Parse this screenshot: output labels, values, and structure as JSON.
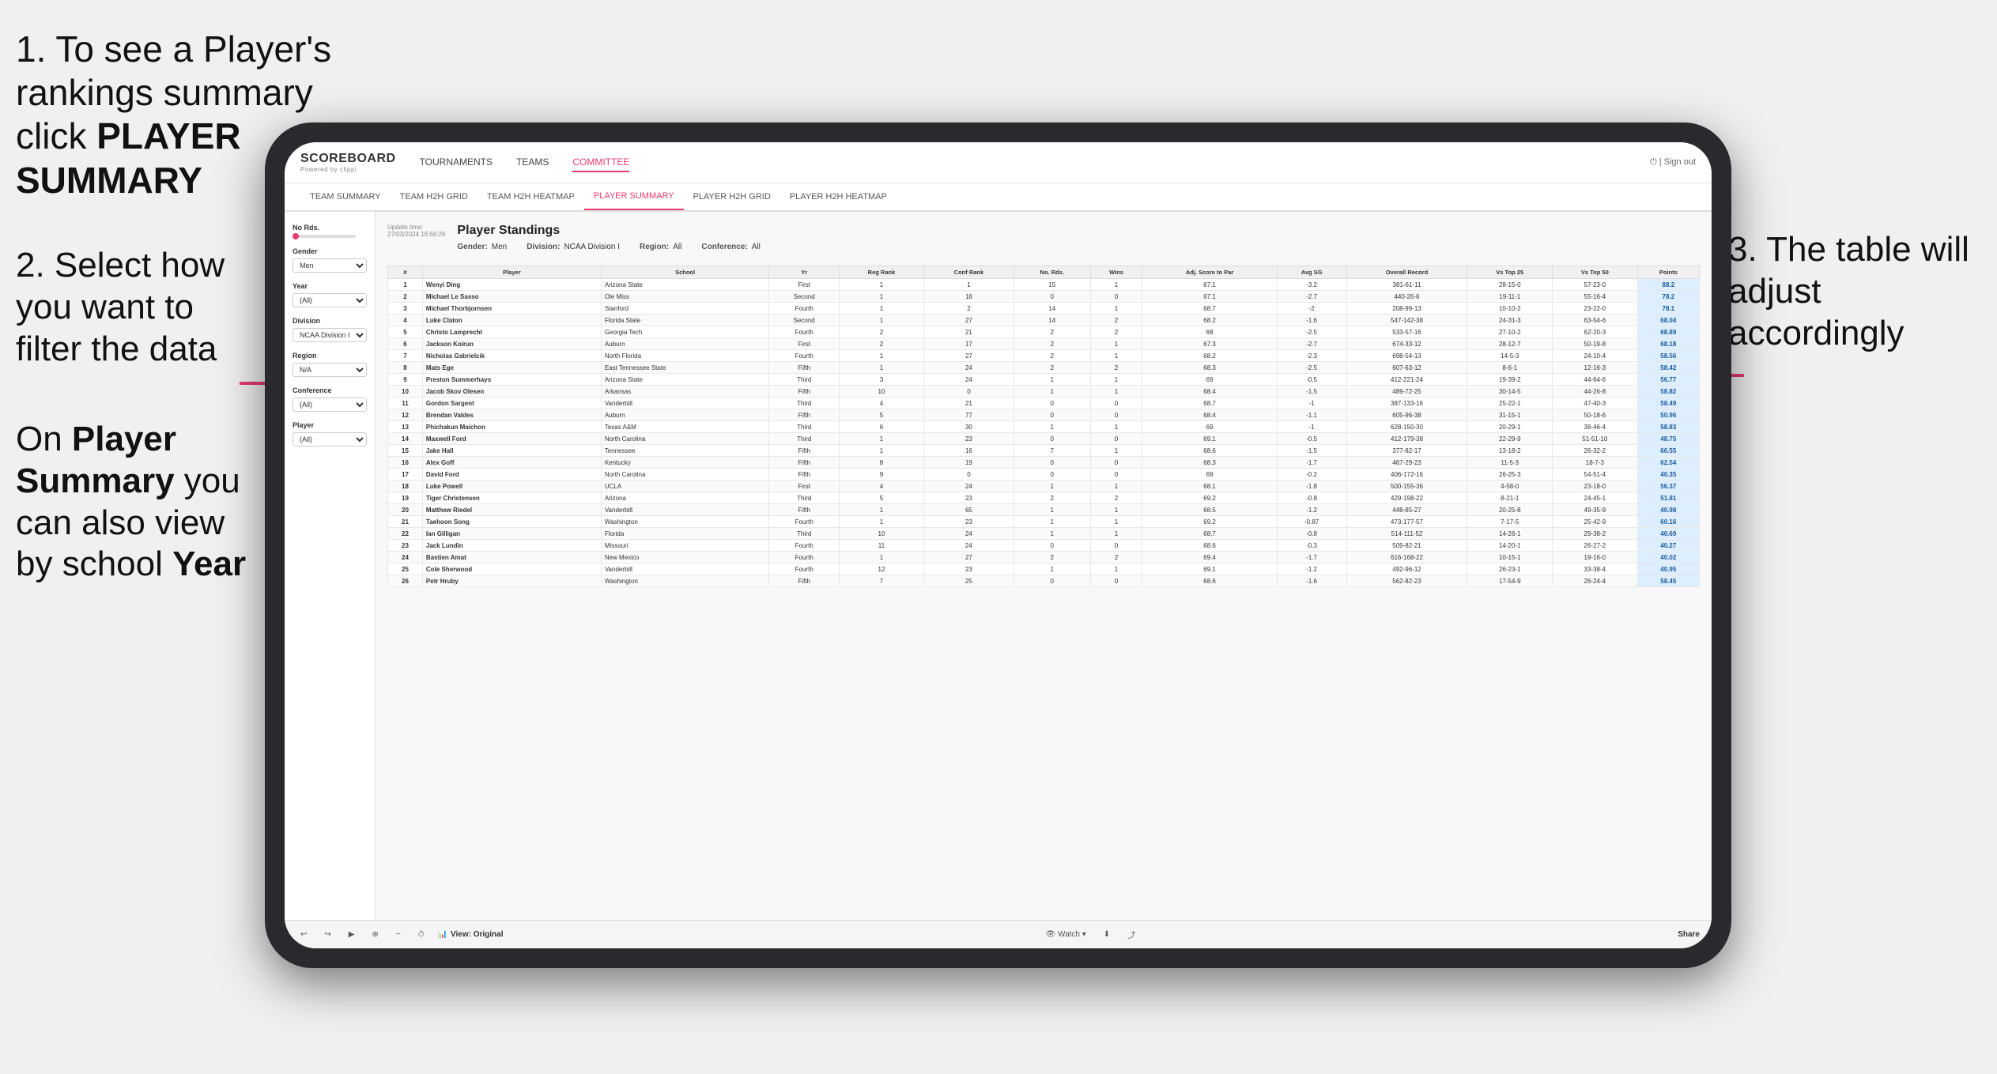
{
  "instructions": {
    "step1": "1. To see a Player's rankings summary click ",
    "step1_bold": "PLAYER SUMMARY",
    "step2_line1": "2. Select how",
    "step2_line2": "you want to",
    "step2_line3": "filter the data",
    "step3": "3. The table will adjust accordingly",
    "bottom_note_pre": "On ",
    "bottom_note_bold1": "Player Summary",
    "bottom_note_mid": " you can also view by school ",
    "bottom_note_bold2": "Year"
  },
  "header": {
    "logo": "SCOREBOARD",
    "logo_sub": "Powered by clippi",
    "sign_out": "Sign out",
    "nav": [
      {
        "label": "TOURNAMENTS",
        "active": false
      },
      {
        "label": "TEAMS",
        "active": false
      },
      {
        "label": "COMMITTEE",
        "active": false
      }
    ],
    "subnav": [
      {
        "label": "TEAM SUMMARY",
        "active": false
      },
      {
        "label": "TEAM H2H GRID",
        "active": false
      },
      {
        "label": "TEAM H2H HEATMAP",
        "active": false
      },
      {
        "label": "PLAYER SUMMARY",
        "active": true
      },
      {
        "label": "PLAYER H2H GRID",
        "active": false
      },
      {
        "label": "PLAYER H2H HEATMAP",
        "active": false
      }
    ]
  },
  "filters": {
    "update_time_label": "Update time:",
    "update_time": "27/03/2024 16:56:26",
    "gender_label": "Gender:",
    "gender_value": "Men",
    "division_label": "Division:",
    "division_value": "NCAA Division I",
    "region_label": "Region:",
    "region_value": "All",
    "conference_label": "Conference:",
    "conference_value": "All"
  },
  "sidebar": {
    "no_rds_label": "No Rds.",
    "gender_label": "Gender",
    "gender_value": "Men",
    "year_label": "Year",
    "year_value": "(All)",
    "division_label": "Division",
    "division_value": "NCAA Division I",
    "region_label": "Region",
    "region_value": "N/A",
    "conference_label": "Conference",
    "conference_value": "(All)",
    "player_label": "Player",
    "player_value": "(All)"
  },
  "table": {
    "title": "Player Standings",
    "columns": [
      "#",
      "Player",
      "School",
      "Yr",
      "Reg Rank",
      "Conf Rank",
      "No. Rds.",
      "Wins",
      "Adj. Score to Par",
      "Avg SG",
      "Overall Record",
      "Vs Top 25",
      "Vs Top 50",
      "Points"
    ],
    "rows": [
      {
        "num": 1,
        "player": "Wenyi Ding",
        "school": "Arizona State",
        "yr": "First",
        "reg_rank": 1,
        "conf_rank": 1,
        "no_rds": 15,
        "wins": 1,
        "adj_score": 67.1,
        "avg_sg": -3.2,
        "overall": "381-61-11",
        "vt25": "28-15-0",
        "vt50": "57-23-0",
        "points": "88.2"
      },
      {
        "num": 2,
        "player": "Michael Le Sasso",
        "school": "Ole Miss",
        "yr": "Second",
        "reg_rank": 1,
        "conf_rank": 18,
        "no_rds": 0,
        "wins": 0,
        "adj_score": 67.1,
        "avg_sg": -2.7,
        "overall": "440-26-6",
        "vt25": "19-11-1",
        "vt50": "55-16-4",
        "points": "78.2"
      },
      {
        "num": 3,
        "player": "Michael Thorbjornsen",
        "school": "Stanford",
        "yr": "Fourth",
        "reg_rank": 1,
        "conf_rank": 2,
        "no_rds": 14,
        "wins": 1,
        "adj_score": 68.7,
        "avg_sg": -2.0,
        "overall": "208-99-13",
        "vt25": "10-10-2",
        "vt50": "23-22-0",
        "points": "78.1"
      },
      {
        "num": 4,
        "player": "Luke Claton",
        "school": "Florida State",
        "yr": "Second",
        "reg_rank": 1,
        "conf_rank": 27,
        "no_rds": 14,
        "wins": 2,
        "adj_score": 68.2,
        "avg_sg": -1.6,
        "overall": "547-142-38",
        "vt25": "24-31-3",
        "vt50": "63-54-6",
        "points": "68.04"
      },
      {
        "num": 5,
        "player": "Christo Lamprecht",
        "school": "Georgia Tech",
        "yr": "Fourth",
        "reg_rank": 2,
        "conf_rank": 21,
        "no_rds": 2,
        "wins": 2,
        "adj_score": 68.0,
        "avg_sg": -2.5,
        "overall": "533-57-16",
        "vt25": "27-10-2",
        "vt50": "62-20-3",
        "points": "68.89"
      },
      {
        "num": 6,
        "player": "Jackson Koirun",
        "school": "Auburn",
        "yr": "First",
        "reg_rank": 2,
        "conf_rank": 17,
        "no_rds": 2,
        "wins": 1,
        "adj_score": 67.3,
        "avg_sg": -2.7,
        "overall": "674-33-12",
        "vt25": "28-12-7",
        "vt50": "50-19-8",
        "points": "68.18"
      },
      {
        "num": 7,
        "player": "Nicholas Gabrielcik",
        "school": "North Florida",
        "yr": "Fourth",
        "reg_rank": 1,
        "conf_rank": 27,
        "no_rds": 2,
        "wins": 1,
        "adj_score": 68.2,
        "avg_sg": -2.3,
        "overall": "698-54-13",
        "vt25": "14-5-3",
        "vt50": "24-10-4",
        "points": "58.56"
      },
      {
        "num": 8,
        "player": "Mats Ege",
        "school": "East Tennessee State",
        "yr": "Fifth",
        "reg_rank": 1,
        "conf_rank": 24,
        "no_rds": 2,
        "wins": 2,
        "adj_score": 68.3,
        "avg_sg": -2.5,
        "overall": "607-63-12",
        "vt25": "8-6-1",
        "vt50": "12-16-3",
        "points": "58.42"
      },
      {
        "num": 9,
        "player": "Preston Summerhays",
        "school": "Arizona State",
        "yr": "Third",
        "reg_rank": 3,
        "conf_rank": 24,
        "no_rds": 1,
        "wins": 1,
        "adj_score": 69.0,
        "avg_sg": -0.5,
        "overall": "412-221-24",
        "vt25": "19-39-2",
        "vt50": "44-64-6",
        "points": "56.77"
      },
      {
        "num": 10,
        "player": "Jacob Skov Olesen",
        "school": "Arkansas",
        "yr": "Fifth",
        "reg_rank": 10,
        "conf_rank": 0,
        "no_rds": 1,
        "wins": 1,
        "adj_score": 68.4,
        "avg_sg": -1.5,
        "overall": "489-72-25",
        "vt25": "30-14-5",
        "vt50": "44-26-8",
        "points": "58.82"
      },
      {
        "num": 11,
        "player": "Gordon Sargent",
        "school": "Vanderbilt",
        "yr": "Third",
        "reg_rank": 4,
        "conf_rank": 21,
        "no_rds": 0,
        "wins": 0,
        "adj_score": 68.7,
        "avg_sg": -1.0,
        "overall": "387-133-16",
        "vt25": "25-22-1",
        "vt50": "47-40-3",
        "points": "58.49"
      },
      {
        "num": 12,
        "player": "Brendan Valdes",
        "school": "Auburn",
        "yr": "Fifth",
        "reg_rank": 5,
        "conf_rank": 77,
        "no_rds": 0,
        "wins": 0,
        "adj_score": 68.4,
        "avg_sg": -1.1,
        "overall": "605-96-38",
        "vt25": "31-15-1",
        "vt50": "50-18-6",
        "points": "50.96"
      },
      {
        "num": 13,
        "player": "Phichakun Maichon",
        "school": "Texas A&M",
        "yr": "Third",
        "reg_rank": 6,
        "conf_rank": 30,
        "no_rds": 1,
        "wins": 1,
        "adj_score": 69.0,
        "avg_sg": -1.0,
        "overall": "628-150-30",
        "vt25": "20-29-1",
        "vt50": "38-46-4",
        "points": "58.83"
      },
      {
        "num": 14,
        "player": "Maxwell Ford",
        "school": "North Carolina",
        "yr": "Third",
        "reg_rank": 1,
        "conf_rank": 23,
        "no_rds": 0,
        "wins": 0,
        "adj_score": 69.1,
        "avg_sg": -0.5,
        "overall": "412-179-38",
        "vt25": "22-29-9",
        "vt50": "51-51-10",
        "points": "48.75"
      },
      {
        "num": 15,
        "player": "Jake Hall",
        "school": "Tennessee",
        "yr": "Fifth",
        "reg_rank": 1,
        "conf_rank": 16,
        "no_rds": 7,
        "wins": 1,
        "adj_score": 68.6,
        "avg_sg": -1.5,
        "overall": "377-82-17",
        "vt25": "13-18-2",
        "vt50": "26-32-2",
        "points": "60.55"
      },
      {
        "num": 16,
        "player": "Alex Goff",
        "school": "Kentucky",
        "yr": "Fifth",
        "reg_rank": 8,
        "conf_rank": 19,
        "no_rds": 0,
        "wins": 0,
        "adj_score": 68.3,
        "avg_sg": -1.7,
        "overall": "467-29-23",
        "vt25": "11-5-3",
        "vt50": "18-7-3",
        "points": "62.54"
      },
      {
        "num": 17,
        "player": "David Ford",
        "school": "North Carolina",
        "yr": "Fifth",
        "reg_rank": 9,
        "conf_rank": 0,
        "no_rds": 0,
        "wins": 0,
        "adj_score": 69.0,
        "avg_sg": -0.2,
        "overall": "406-172-16",
        "vt25": "26-25-3",
        "vt50": "54-51-4",
        "points": "40.35"
      },
      {
        "num": 18,
        "player": "Luke Powell",
        "school": "UCLA",
        "yr": "First",
        "reg_rank": 4,
        "conf_rank": 24,
        "no_rds": 1,
        "wins": 1,
        "adj_score": 68.1,
        "avg_sg": -1.8,
        "overall": "500-155-36",
        "vt25": "4-58-0",
        "vt50": "23-18-0",
        "points": "56.37"
      },
      {
        "num": 19,
        "player": "Tiger Christensen",
        "school": "Arizona",
        "yr": "Third",
        "reg_rank": 5,
        "conf_rank": 23,
        "no_rds": 2,
        "wins": 2,
        "adj_score": 69.2,
        "avg_sg": -0.8,
        "overall": "429-198-22",
        "vt25": "8-21-1",
        "vt50": "24-45-1",
        "points": "51.81"
      },
      {
        "num": 20,
        "player": "Matthew Riedel",
        "school": "Vanderbilt",
        "yr": "Fifth",
        "reg_rank": 1,
        "conf_rank": 65,
        "no_rds": 1,
        "wins": 1,
        "adj_score": 68.5,
        "avg_sg": -1.2,
        "overall": "448-85-27",
        "vt25": "20-25-8",
        "vt50": "49-35-9",
        "points": "40.98"
      },
      {
        "num": 21,
        "player": "Taehoon Song",
        "school": "Washington",
        "yr": "Fourth",
        "reg_rank": 1,
        "conf_rank": 23,
        "no_rds": 1,
        "wins": 1,
        "adj_score": 69.2,
        "avg_sg": -0.87,
        "overall": "473-177-57",
        "vt25": "7-17-5",
        "vt50": "25-42-9",
        "points": "60.16"
      },
      {
        "num": 22,
        "player": "Ian Gilligan",
        "school": "Florida",
        "yr": "Third",
        "reg_rank": 10,
        "conf_rank": 24,
        "no_rds": 1,
        "wins": 1,
        "adj_score": 68.7,
        "avg_sg": -0.8,
        "overall": "514-111-52",
        "vt25": "14-26-1",
        "vt50": "29-38-2",
        "points": "40.69"
      },
      {
        "num": 23,
        "player": "Jack Lundin",
        "school": "Missouri",
        "yr": "Fourth",
        "reg_rank": 11,
        "conf_rank": 24,
        "no_rds": 0,
        "wins": 0,
        "adj_score": 68.6,
        "avg_sg": -0.3,
        "overall": "509-82-21",
        "vt25": "14-20-1",
        "vt50": "26-27-2",
        "points": "40.27"
      },
      {
        "num": 24,
        "player": "Bastien Amat",
        "school": "New Mexico",
        "yr": "Fourth",
        "reg_rank": 1,
        "conf_rank": 27,
        "no_rds": 2,
        "wins": 2,
        "adj_score": 69.4,
        "avg_sg": -1.7,
        "overall": "616-168-22",
        "vt25": "10-15-1",
        "vt50": "19-16-0",
        "points": "40.02"
      },
      {
        "num": 25,
        "player": "Cole Sherwood",
        "school": "Vanderbilt",
        "yr": "Fourth",
        "reg_rank": 12,
        "conf_rank": 23,
        "no_rds": 1,
        "wins": 1,
        "adj_score": 69.1,
        "avg_sg": -1.2,
        "overall": "492-96-12",
        "vt25": "26-23-1",
        "vt50": "33-38-4",
        "points": "40.95"
      },
      {
        "num": 26,
        "player": "Petr Hruby",
        "school": "Washington",
        "yr": "Fifth",
        "reg_rank": 7,
        "conf_rank": 25,
        "no_rds": 0,
        "wins": 0,
        "adj_score": 68.6,
        "avg_sg": -1.6,
        "overall": "562-82-23",
        "vt25": "17-54-9",
        "vt50": "26-24-4",
        "points": "58.45"
      }
    ]
  },
  "toolbar": {
    "view_original": "View: Original",
    "watch": "Watch",
    "share": "Share"
  }
}
